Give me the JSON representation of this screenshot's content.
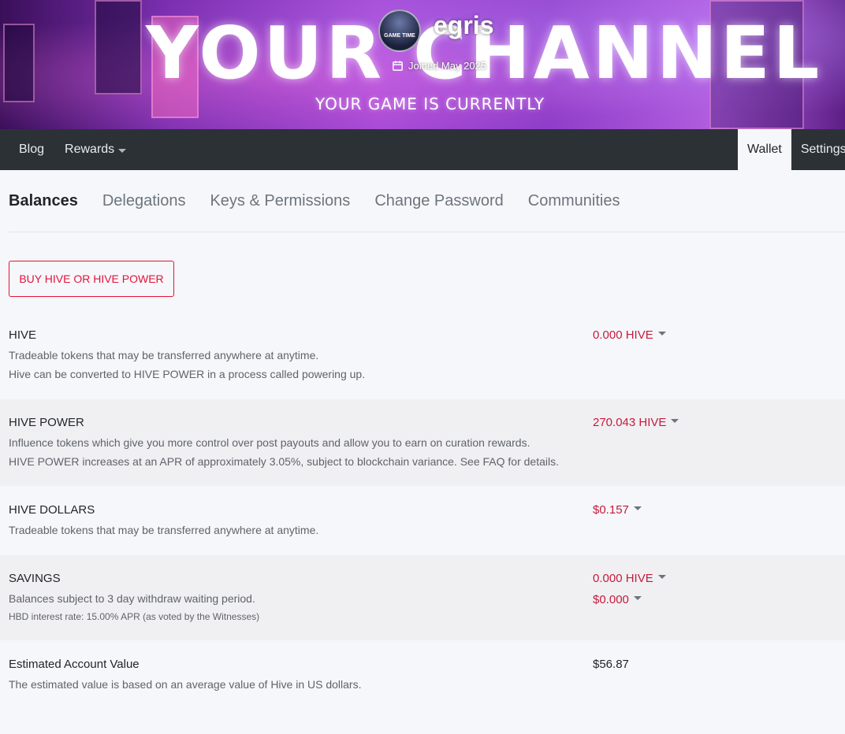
{
  "banner": {
    "title": "YOUR CHANNEL",
    "subtitle": "YOUR GAME IS CURRENTLY",
    "avatar_text": "GAME TIME",
    "username": "egris",
    "joined": "Joined May 2025"
  },
  "nav": {
    "blog": "Blog",
    "rewards": "Rewards",
    "wallet": "Wallet",
    "settings": "Settings"
  },
  "tabs": {
    "balances": "Balances",
    "delegations": "Delegations",
    "keys": "Keys & Permissions",
    "password": "Change Password",
    "communities": "Communities"
  },
  "buy_button": "BUY HIVE OR HIVE POWER",
  "balances": {
    "hive": {
      "label": "HIVE",
      "desc1": "Tradeable tokens that may be transferred anywhere at anytime.",
      "desc2": "Hive can be converted to HIVE POWER in a process called powering up.",
      "value": "0.000 HIVE"
    },
    "hive_power": {
      "label": "HIVE POWER",
      "desc1": "Influence tokens which give you more control over post payouts and allow you to earn on curation rewards.",
      "desc2": "HIVE POWER increases at an APR of approximately 3.05%, subject to blockchain variance. See FAQ for details.",
      "value": "270.043 HIVE"
    },
    "hive_dollars": {
      "label": "HIVE DOLLARS",
      "desc1": "Tradeable tokens that may be transferred anywhere at anytime.",
      "value": "$0.157"
    },
    "savings": {
      "label": "SAVINGS",
      "desc1": "Balances subject to 3 day withdraw waiting period.",
      "desc2": "HBD interest rate: 15.00% APR (as voted by the Witnesses)",
      "value_hive": "0.000 HIVE",
      "value_hbd": "$0.000"
    },
    "estimated": {
      "label": "Estimated Account Value",
      "desc1": "The estimated value is based on an average value of Hive in US dollars.",
      "value": "$56.87"
    }
  },
  "colors": {
    "accent": "#e31337",
    "nav_bg": "#2c3136",
    "page_bg": "#f6f7fb"
  }
}
